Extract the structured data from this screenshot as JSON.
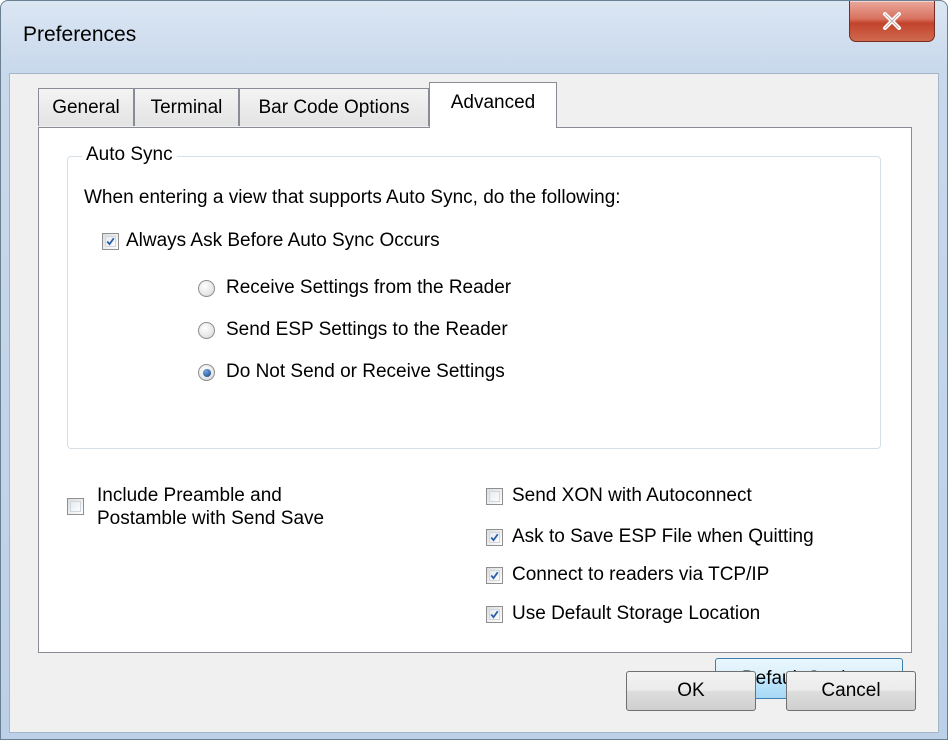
{
  "window": {
    "title": "Preferences"
  },
  "tabs": [
    {
      "label": "General",
      "active": false
    },
    {
      "label": "Terminal",
      "active": false
    },
    {
      "label": "Bar Code Options",
      "active": false
    },
    {
      "label": "Advanced",
      "active": true
    }
  ],
  "auto_sync": {
    "legend": "Auto Sync",
    "description": "When entering a view that supports Auto Sync, do the following:",
    "always_ask": {
      "label": "Always Ask Before Auto Sync Occurs",
      "checked": true
    },
    "options": [
      {
        "label": "Receive Settings from the Reader",
        "selected": false
      },
      {
        "label": "Send ESP Settings to the Reader",
        "selected": false
      },
      {
        "label": "Do Not Send or Receive Settings",
        "selected": true
      }
    ]
  },
  "include_preamble": {
    "label_line1": "Include Preamble and",
    "label_line2": "Postamble with Send Save",
    "checked": false
  },
  "right_options": [
    {
      "label": "Send XON with Autoconnect",
      "checked": false
    },
    {
      "label": "Ask to Save ESP File when Quitting",
      "checked": true
    },
    {
      "label": "Connect to readers via TCP/IP",
      "checked": true
    },
    {
      "label": "Use Default Storage Location",
      "checked": true
    }
  ],
  "buttons": {
    "default_settings": "Default Settings",
    "ok": "OK",
    "cancel": "Cancel"
  },
  "colors": {
    "check_blue": "#2c5fa8",
    "title_bar": "#c9d9ec",
    "close_red": "#c2432c"
  }
}
